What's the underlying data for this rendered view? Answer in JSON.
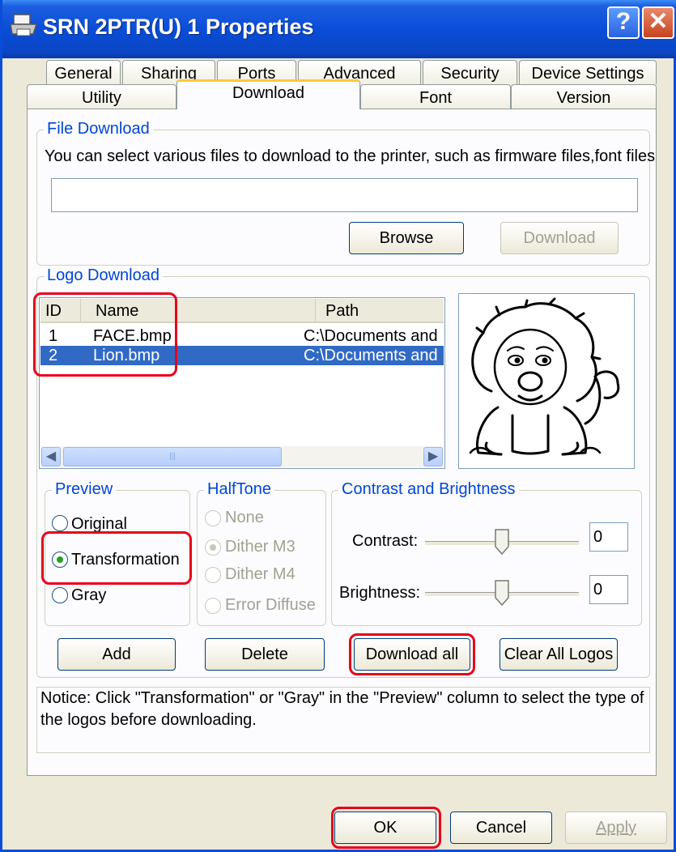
{
  "window": {
    "title": "SRN 2PTR(U) 1 Properties",
    "help_glyph": "?",
    "close_glyph": "✕"
  },
  "tabs": {
    "row1": [
      "General",
      "Sharing",
      "Ports",
      "Advanced",
      "Security",
      "Device Settings"
    ],
    "row2": [
      "Utility",
      "Download",
      "Font",
      "Version"
    ],
    "active": "Download"
  },
  "file_download": {
    "legend": "File Download",
    "description": "You can select various files to download to the printer, such as firmware files,font files",
    "path_value": "",
    "browse_label": "Browse",
    "download_label": "Download"
  },
  "logo_download": {
    "legend": "Logo Download",
    "columns": [
      "ID",
      "Name",
      "Path"
    ],
    "rows": [
      {
        "id": "1",
        "name": "FACE.bmp",
        "path": "C:\\Documents and",
        "selected": false
      },
      {
        "id": "2",
        "name": "Lion.bmp",
        "path": "C:\\Documents and",
        "selected": true
      }
    ],
    "preview_icon": "lion-drawing"
  },
  "preview": {
    "legend": "Preview",
    "options": [
      "Original",
      "Transformation",
      "Gray"
    ],
    "selected": "Transformation"
  },
  "halftone": {
    "legend": "HalfTone",
    "options": [
      "None",
      "Dither M3",
      "Dither M4",
      "Error Diffuse"
    ],
    "selected": "Dither M3",
    "enabled": false
  },
  "contrast_brightness": {
    "legend": "Contrast and Brightness",
    "contrast_label": "Contrast:",
    "contrast_value": "0",
    "brightness_label": "Brightness:",
    "brightness_value": "0"
  },
  "actions": {
    "add": "Add",
    "delete": "Delete",
    "download_all": "Download all",
    "clear_all": "Clear All Logos"
  },
  "notice": "Notice: Click \"Transformation\" or \"Gray\" in the \"Preview\" column to select the type of the logos before downloading.",
  "footer": {
    "ok": "OK",
    "cancel": "Cancel",
    "apply": "Apply"
  },
  "colors": {
    "title_bar": "#0a4dd8",
    "legend_blue": "#0046d5",
    "selection": "#316ac5",
    "highlight_red": "#e8001c"
  }
}
